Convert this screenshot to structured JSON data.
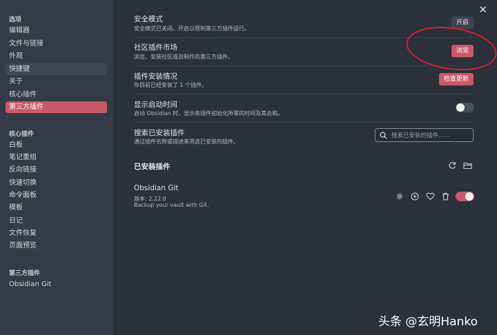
{
  "sidebar": {
    "section_options": "选项",
    "options_items": [
      "编辑器",
      "文件与链接",
      "外观",
      "快捷键",
      "关于",
      "核心插件",
      "第三方插件"
    ],
    "section_core": "核心插件",
    "core_items": [
      "白板",
      "笔记重组",
      "反向链接",
      "快速切换",
      "命令面板",
      "模板",
      "日记",
      "文件恢复",
      "页面预览"
    ],
    "section_third": "第三方插件",
    "third_items": [
      "Obsidian Git"
    ]
  },
  "settings": {
    "safe_mode": {
      "title": "安全模式",
      "desc": "安全模式已关闭。开启以限制第三方插件运行。",
      "button": "开启"
    },
    "community": {
      "title": "社区插件市场",
      "desc": "浏览、安装社区成员制作的第三方插件。",
      "button": "浏览"
    },
    "installed_status": {
      "title": "插件安装情况",
      "desc": "你目前已经安装了 1 个插件。",
      "button": "检查更新"
    },
    "startup_time": {
      "title": "显示启动时间",
      "desc": "启动 Obsidian 时，显示各插件初始化所需的时间及其总和。",
      "toggle": "off"
    },
    "search_installed": {
      "title": "搜索已安装插件",
      "desc": "通过插件名称或描述来筛选已安装的插件。",
      "placeholder": "搜索已安装的插件……"
    }
  },
  "installed_plugins": {
    "heading": "已安装插件",
    "items": [
      {
        "name": "Obsidian Git",
        "version": "版本: 2.22.0",
        "desc": "Backup your vault with Git.",
        "enabled": true
      }
    ]
  },
  "icons": [
    "close-icon",
    "search-icon",
    "reload-icon",
    "folder-icon",
    "gear-icon",
    "plus-circle-icon",
    "heart-icon",
    "trash-icon"
  ],
  "colors": {
    "accent": "#c85a67",
    "annotation": "#d8222a"
  },
  "watermark": "头条 @玄明Hanko"
}
